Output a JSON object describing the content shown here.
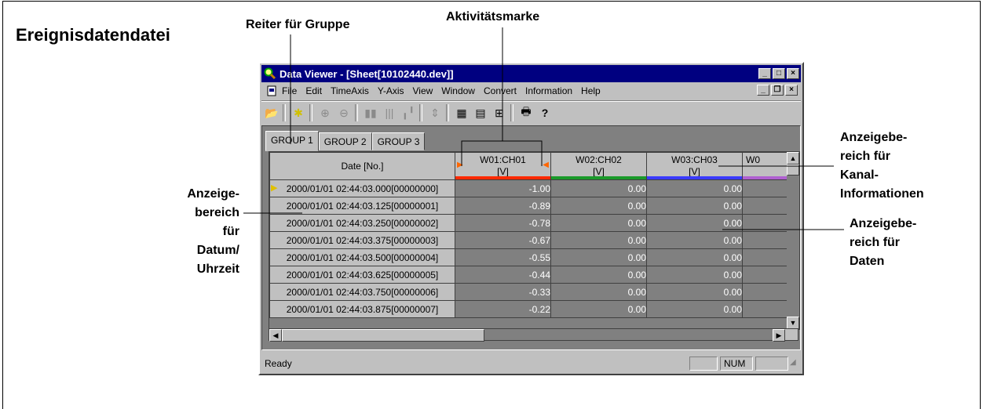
{
  "section_title": "Ereignisdatendatei",
  "callouts": {
    "tab": "Reiter für Gruppe",
    "activity": "Aktivitätsmarke",
    "channel_info": [
      "Anzeigebe-",
      "reich für",
      "Kanal-",
      "Informationen"
    ],
    "date_area": [
      "Anzeige-",
      "bereich",
      "für",
      "Datum/",
      "Uhrzeit"
    ],
    "data_area": [
      "Anzeigebe-",
      "reich für",
      "Daten"
    ]
  },
  "window": {
    "title": "Data Viewer - [Sheet[10102440.dev]]",
    "menu": [
      "File",
      "Edit",
      "TimeAxis",
      "Y-Axis",
      "View",
      "Window",
      "Convert",
      "Information",
      "Help"
    ],
    "tabs": [
      "GROUP 1",
      "GROUP 2",
      "GROUP 3"
    ],
    "date_header": "Date [No.]",
    "columns": [
      {
        "name": "W01:CH01",
        "unit": "[V]",
        "color": "#ff2a00"
      },
      {
        "name": "W02:CH02",
        "unit": "[V]",
        "color": "#1a9a2a"
      },
      {
        "name": "W03:CH03",
        "unit": "[V]",
        "color": "#3a3aff"
      },
      {
        "name": "W0",
        "unit": "",
        "color": "#b060d0"
      }
    ],
    "rows": [
      {
        "date": "2000/01/01 02:44:03.000[00000000]",
        "v": [
          "-1.00",
          "0.00",
          "0.00"
        ]
      },
      {
        "date": "2000/01/01 02:44:03.125[00000001]",
        "v": [
          "-0.89",
          "0.00",
          "0.00"
        ]
      },
      {
        "date": "2000/01/01 02:44:03.250[00000002]",
        "v": [
          "-0.78",
          "0.00",
          "0.00"
        ]
      },
      {
        "date": "2000/01/01 02:44:03.375[00000003]",
        "v": [
          "-0.67",
          "0.00",
          "0.00"
        ]
      },
      {
        "date": "2000/01/01 02:44:03.500[00000004]",
        "v": [
          "-0.55",
          "0.00",
          "0.00"
        ]
      },
      {
        "date": "2000/01/01 02:44:03.625[00000005]",
        "v": [
          "-0.44",
          "0.00",
          "0.00"
        ]
      },
      {
        "date": "2000/01/01 02:44:03.750[00000006]",
        "v": [
          "-0.33",
          "0.00",
          "0.00"
        ]
      },
      {
        "date": "2000/01/01 02:44:03.875[00000007]",
        "v": [
          "-0.22",
          "0.00",
          "0.00"
        ]
      }
    ],
    "status": "Ready",
    "status_num": "NUM"
  }
}
